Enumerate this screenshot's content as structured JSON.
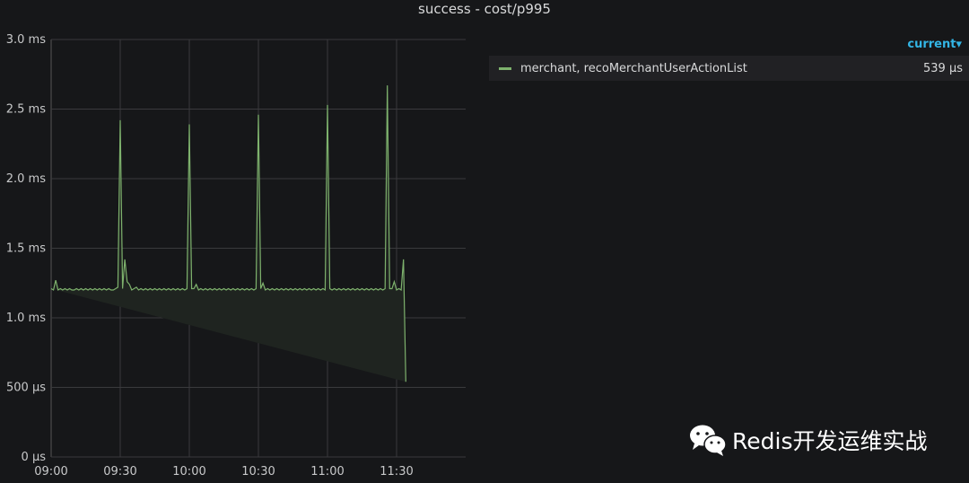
{
  "panel": {
    "title": "success - cost/p995"
  },
  "legend": {
    "column_header": "current▾",
    "items": [
      {
        "name": "merchant, recoMerchantUserActionList",
        "current": "539 µs",
        "color": "#7eb26d"
      }
    ]
  },
  "watermark": {
    "text": "Redis开发运维实战",
    "icon": "wechat-icon"
  },
  "chart_data": {
    "type": "area",
    "title": "success - cost/p995",
    "xlabel": "",
    "ylabel": "",
    "x_ticks": [
      "09:00",
      "09:30",
      "10:00",
      "10:30",
      "11:00",
      "11:30"
    ],
    "y_ticks": [
      "0 µs",
      "500 µs",
      "1.0 ms",
      "1.5 ms",
      "2.0 ms",
      "2.5 ms",
      "3.0 ms"
    ],
    "ylim_ms": [
      0,
      3.0
    ],
    "xlim": [
      "09:00",
      "12:00"
    ],
    "x_tick_minutes": [
      0,
      30,
      60,
      90,
      120,
      150
    ],
    "y_tick_ms": [
      0,
      0.5,
      1.0,
      1.5,
      2.0,
      2.5,
      3.0
    ],
    "grid": true,
    "legend_position": "right",
    "series": [
      {
        "name": "merchant, recoMerchantUserActionList",
        "color": "#7eb26d",
        "x_minutes": [
          0,
          1,
          2,
          3,
          4,
          5,
          6,
          7,
          8,
          9,
          10,
          11,
          12,
          13,
          14,
          15,
          16,
          17,
          18,
          19,
          20,
          21,
          22,
          23,
          24,
          25,
          26,
          27,
          28,
          29,
          30,
          31,
          32,
          33,
          34,
          35,
          36,
          37,
          38,
          39,
          40,
          41,
          42,
          43,
          44,
          45,
          46,
          47,
          48,
          49,
          50,
          51,
          52,
          53,
          54,
          55,
          56,
          57,
          58,
          59,
          60,
          61,
          62,
          63,
          64,
          65,
          66,
          67,
          68,
          69,
          70,
          71,
          72,
          73,
          74,
          75,
          76,
          77,
          78,
          79,
          80,
          81,
          82,
          83,
          84,
          85,
          86,
          87,
          88,
          89,
          90,
          91,
          92,
          93,
          94,
          95,
          96,
          97,
          98,
          99,
          100,
          101,
          102,
          103,
          104,
          105,
          106,
          107,
          108,
          109,
          110,
          111,
          112,
          113,
          114,
          115,
          116,
          117,
          118,
          119,
          120,
          121,
          122,
          123,
          124,
          125,
          126,
          127,
          128,
          129,
          130,
          131,
          132,
          133,
          134,
          135,
          136,
          137,
          138,
          139,
          140,
          141,
          142,
          143,
          144,
          145,
          146,
          147,
          148,
          149,
          150,
          151,
          152,
          153,
          154,
          155,
          156,
          157,
          158,
          159,
          160
        ],
        "values_ms": [
          1.21,
          1.2,
          1.27,
          1.2,
          1.21,
          1.2,
          1.21,
          1.2,
          1.21,
          1.2,
          1.2,
          1.21,
          1.2,
          1.21,
          1.2,
          1.21,
          1.2,
          1.21,
          1.2,
          1.21,
          1.2,
          1.21,
          1.2,
          1.21,
          1.2,
          1.21,
          1.2,
          1.2,
          1.21,
          1.22,
          2.42,
          1.21,
          1.42,
          1.26,
          1.24,
          1.2,
          1.21,
          1.22,
          1.2,
          1.21,
          1.2,
          1.21,
          1.2,
          1.21,
          1.2,
          1.21,
          1.2,
          1.21,
          1.2,
          1.21,
          1.2,
          1.21,
          1.2,
          1.21,
          1.2,
          1.21,
          1.2,
          1.21,
          1.2,
          1.21,
          2.39,
          1.21,
          1.21,
          1.24,
          1.2,
          1.21,
          1.2,
          1.21,
          1.2,
          1.21,
          1.2,
          1.21,
          1.2,
          1.21,
          1.2,
          1.21,
          1.2,
          1.21,
          1.2,
          1.21,
          1.2,
          1.21,
          1.2,
          1.21,
          1.2,
          1.21,
          1.2,
          1.21,
          1.2,
          1.21,
          2.46,
          1.21,
          1.25,
          1.2,
          1.21,
          1.2,
          1.21,
          1.2,
          1.21,
          1.2,
          1.21,
          1.2,
          1.21,
          1.2,
          1.21,
          1.2,
          1.21,
          1.2,
          1.21,
          1.2,
          1.21,
          1.2,
          1.21,
          1.2,
          1.21,
          1.2,
          1.21,
          1.2,
          1.21,
          1.2,
          2.53,
          1.21,
          1.2,
          1.21,
          1.2,
          1.21,
          1.2,
          1.21,
          1.2,
          1.21,
          1.2,
          1.21,
          1.2,
          1.21,
          1.2,
          1.21,
          1.2,
          1.21,
          1.2,
          1.21,
          1.2,
          1.21,
          1.2,
          1.21,
          1.2,
          1.21,
          2.67,
          1.21,
          1.21,
          1.26,
          1.2,
          1.21,
          1.2,
          1.42,
          0.54
        ]
      }
    ]
  }
}
